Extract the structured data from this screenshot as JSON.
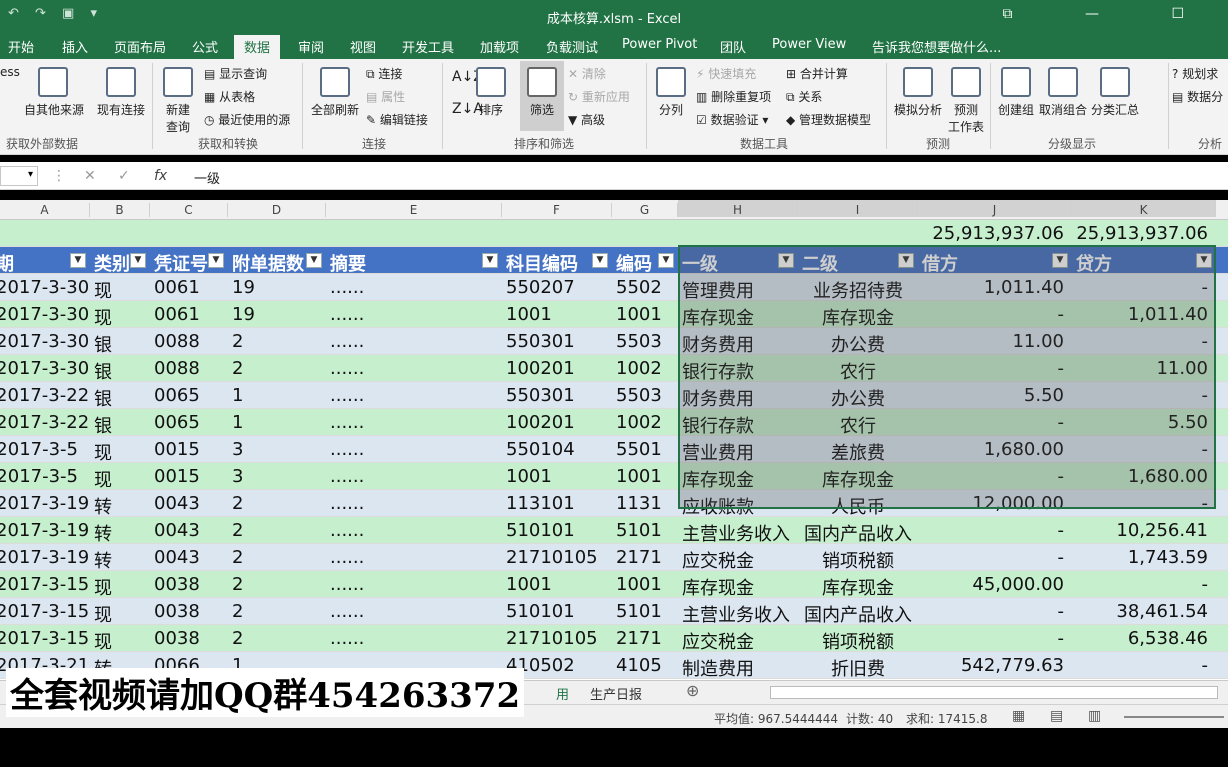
{
  "title": {
    "text": "成本核算.xlsm - Excel"
  },
  "tabs": [
    "开始",
    "插入",
    "页面布局",
    "公式",
    "数据",
    "审阅",
    "视图",
    "开发工具",
    "加载项",
    "负载测试",
    "Power Pivot",
    "团队",
    "Power View"
  ],
  "tab_active": "数据",
  "tell_me": "告诉我您想要做什么...",
  "ribbon": {
    "g1": {
      "cut": "ess",
      "b1": "自其他来源",
      "b2": "现有连接",
      "label": "获取外部数据"
    },
    "g2": {
      "new_query": "新建",
      "new_query2": "查询",
      "show": "显示查询",
      "from_table": "从表格",
      "recent": "最近使用的源",
      "label": "获取和转换"
    },
    "g3": {
      "refresh": "全部刷新",
      "conn": "连接",
      "props": "属性",
      "edit_links": "编辑链接",
      "label": "连接"
    },
    "g4": {
      "sort": "排序",
      "filter": "筛选",
      "clear": "清除",
      "reapply": "重新应用",
      "advanced": "高级",
      "label": "排序和筛选"
    },
    "g5": {
      "split": "分列",
      "flash": "快速填充",
      "dedupe": "删除重复项",
      "validate": "数据验证",
      "merge": "合并计算",
      "relations": "关系",
      "model": "管理数据模型",
      "label": "数据工具"
    },
    "g6": {
      "whatif": "模拟分析",
      "forecast": "预测",
      "forecast2": "工作表",
      "label": "预测"
    },
    "g7": {
      "group": "创建组",
      "ungroup": "取消组合",
      "subtotal": "分类汇总",
      "label": "分级显示"
    },
    "g8": {
      "solver": "规划求",
      "data_anal": "数据分",
      "label": "分析"
    }
  },
  "formula_bar": {
    "value": "一级",
    "fx": "fx"
  },
  "columns": [
    "A",
    "B",
    "C",
    "D",
    "E",
    "F",
    "G",
    "H",
    "I",
    "J",
    "K"
  ],
  "totals": {
    "j": "25,913,937.06",
    "k": "25,913,937.06"
  },
  "headers": [
    "期",
    "类别",
    "凭证号",
    "附单据数",
    "摘要",
    "科目编码",
    "编码",
    "一级",
    "二级",
    "借方",
    "贷方"
  ],
  "rows": [
    [
      "2017-3-30",
      "现",
      "0061",
      "19",
      "......",
      "550207",
      "5502",
      "管理费用",
      "业务招待费",
      "1,011.40",
      "-"
    ],
    [
      "2017-3-30",
      "现",
      "0061",
      "19",
      "......",
      "1001",
      "1001",
      "库存现金",
      "库存现金",
      "-",
      "1,011.40"
    ],
    [
      "2017-3-30",
      "银",
      "0088",
      "2",
      "......",
      "550301",
      "5503",
      "财务费用",
      "办公费",
      "11.00",
      "-"
    ],
    [
      "2017-3-30",
      "银",
      "0088",
      "2",
      "......",
      "100201",
      "1002",
      "银行存款",
      "农行",
      "-",
      "11.00"
    ],
    [
      "2017-3-22",
      "银",
      "0065",
      "1",
      "......",
      "550301",
      "5503",
      "财务费用",
      "办公费",
      "5.50",
      "-"
    ],
    [
      "2017-3-22",
      "银",
      "0065",
      "1",
      "......",
      "100201",
      "1002",
      "银行存款",
      "农行",
      "-",
      "5.50"
    ],
    [
      "2017-3-5",
      "现",
      "0015",
      "3",
      "......",
      "550104",
      "5501",
      "营业费用",
      "差旅费",
      "1,680.00",
      "-"
    ],
    [
      "2017-3-5",
      "现",
      "0015",
      "3",
      "......",
      "1001",
      "1001",
      "库存现金",
      "库存现金",
      "-",
      "1,680.00"
    ],
    [
      "2017-3-19",
      "转",
      "0043",
      "2",
      "......",
      "113101",
      "1131",
      "应收账款",
      "人民币",
      "12,000.00",
      "-"
    ],
    [
      "2017-3-19",
      "转",
      "0043",
      "2",
      "......",
      "510101",
      "5101",
      "主营业务收入",
      "国内产品收入",
      "-",
      "10,256.41"
    ],
    [
      "2017-3-19",
      "转",
      "0043",
      "2",
      "......",
      "21710105",
      "2171",
      "应交税金",
      "销项税额",
      "-",
      "1,743.59"
    ],
    [
      "2017-3-15",
      "现",
      "0038",
      "2",
      "......",
      "1001",
      "1001",
      "库存现金",
      "库存现金",
      "45,000.00",
      "-"
    ],
    [
      "2017-3-15",
      "现",
      "0038",
      "2",
      "......",
      "510101",
      "5101",
      "主营业务收入",
      "国内产品收入",
      "-",
      "38,461.54"
    ],
    [
      "2017-3-15",
      "现",
      "0038",
      "2",
      "......",
      "21710105",
      "2171",
      "应交税金",
      "销项税额",
      "-",
      "6,538.46"
    ],
    [
      "2017-3-21",
      "转",
      "0066",
      "1",
      "......",
      "410502",
      "4105",
      "制造费用",
      "折旧费",
      "542,779.63",
      "-"
    ]
  ],
  "sheets": {
    "active_tail": "用",
    "other": "生产日报"
  },
  "status": {
    "avg": "平均值: 967.5444444",
    "count": "计数: 40",
    "sum": "求和: 17415.8"
  },
  "overlay_text": "全套视频请加QQ群454263372",
  "colors": {
    "excel_green": "#217346",
    "header_blue": "#4472c4",
    "band_blue": "#dce6f1",
    "band_green": "#c6efce"
  }
}
